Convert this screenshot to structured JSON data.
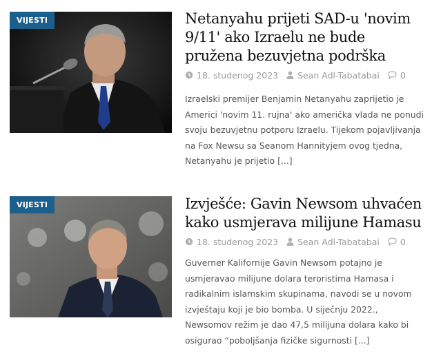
{
  "articles": [
    {
      "category": "VIJESTI",
      "title": "Netanyahu prijeti SAD-u 'novim 9/11' ako Izraelu ne bude pružena bezuvjetna podrška",
      "date": "18. studenog 2023",
      "author": "Sean Adl-Tabatabai",
      "comments": "0",
      "excerpt": "Izraelski premijer Benjamin Netanyahu zaprijetio je Americi 'novim 11. rujna' ako američka vlada ne ponudi svoju bezuvjetnu potporu Izraelu. Tijekom pojavljivanja na Fox Newsu sa Seanom Hannityjem ovog tjedna, Netanyahu je prijetio",
      "more": "[...]"
    },
    {
      "category": "VIJESTI",
      "title": "Izvješće: Gavin Newsom uhvaćen kako usmjerava milijune Hamasu",
      "date": "18. studenog 2023",
      "author": "Sean Adl-Tabatabai",
      "comments": "0",
      "excerpt": "Guverner Kalifornije Gavin Newsom potajno je usmjeravao milijune dolara teroristima Hamasa i radikalnim islamskim skupinama, navodi se u novom izvještaju koji je bio bomba. U siječnju 2022., Newsomov režim je dao 47,5 milijuna dolara kako bi osigurao “poboljšanja fizičke sigurnosti",
      "more": "[...]"
    }
  ],
  "colors": {
    "badge": "#1c5f8c",
    "title": "#111111",
    "meta": "#9a9a9a",
    "excerpt": "#555555"
  },
  "icons": {
    "date": "clock-icon",
    "author": "user-icon",
    "comments": "comment-icon"
  }
}
